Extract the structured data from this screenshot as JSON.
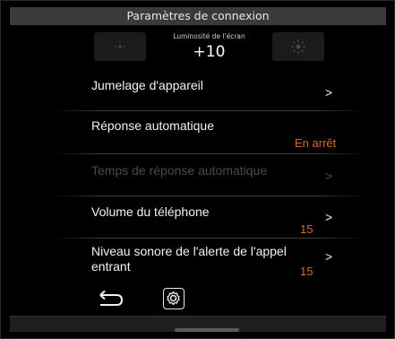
{
  "header": {
    "title": "Paramètres de connexion"
  },
  "brightness": {
    "label": "Luminosité de l'écran",
    "value": "+10",
    "decrease_icon": "sun-dim-icon",
    "increase_icon": "sun-bright-icon"
  },
  "menu": {
    "items": [
      {
        "title": "Jumelage d'appareil",
        "value": "",
        "chevron": ">",
        "enabled": true
      },
      {
        "title": "Réponse automatique",
        "value": "En arrêt",
        "chevron": "",
        "enabled": true
      },
      {
        "title": "Temps de réponse automatique",
        "value": "",
        "chevron": ">",
        "enabled": false
      },
      {
        "title": "Volume du téléphone",
        "value": "15",
        "chevron": ">",
        "enabled": true
      },
      {
        "title": "Niveau sonore de l'alerte de l'appel entrant",
        "title_line1": "Niveau sonore de l'alerte de l'appel",
        "title_line2": "entrant",
        "value": "15",
        "chevron": ">",
        "enabled": true
      }
    ]
  },
  "footer": {
    "back_icon": "back-arrow-icon",
    "settings_icon": "settings-gear-icon"
  },
  "colors": {
    "accent": "#e2641e",
    "header_bg": "#3a3a3a",
    "background": "#000000",
    "disabled_text": "#4a4a4a"
  }
}
